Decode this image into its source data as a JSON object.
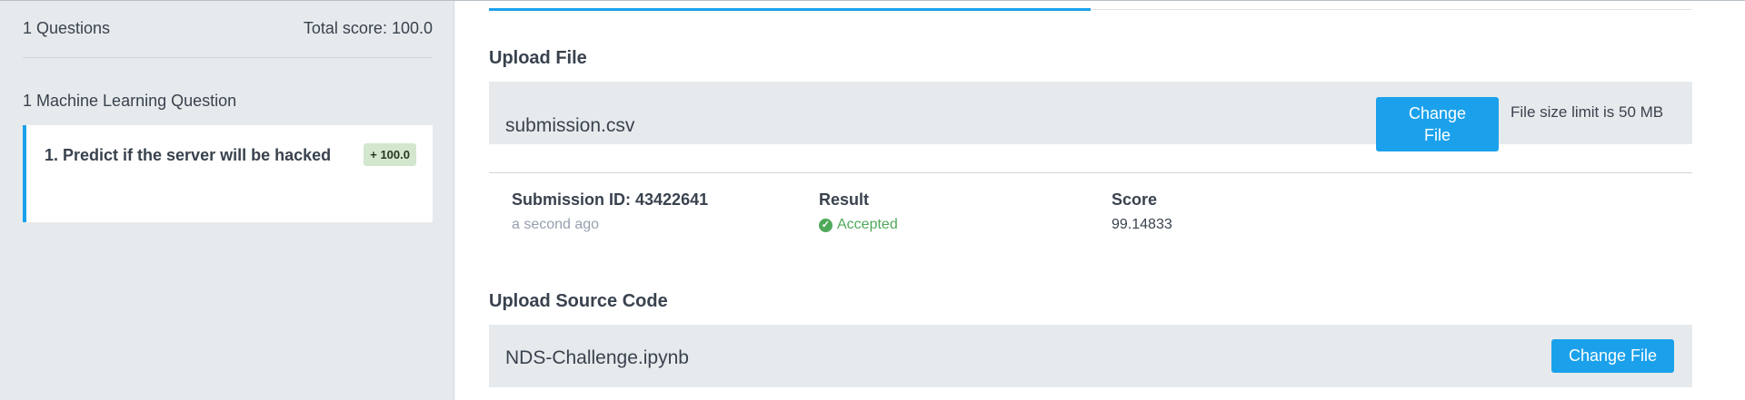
{
  "sidebar": {
    "questions_count": "1 Questions",
    "total_score": "Total score: 100.0",
    "section_title": "1 Machine Learning Question",
    "question": {
      "title": "1. Predict if the server will be hacked",
      "badge": "+ 100.0"
    }
  },
  "upload_file": {
    "heading": "Upload File",
    "file_name": "submission.csv",
    "button_label": "Change File",
    "limit_text": "File size limit is 50 MB"
  },
  "submission": {
    "id_label": "Submission ID: 43422641",
    "time": "a second ago",
    "result_label": "Result",
    "result_value": "Accepted",
    "score_label": "Score",
    "score_value": "99.14833"
  },
  "upload_source": {
    "heading": "Upload Source Code",
    "file_name": "NDS-Challenge.ipynb",
    "button_label": "Change File"
  },
  "colors": {
    "accent": "#1ba1ec",
    "success": "#4fa95a",
    "panel_bg": "#e7eaec"
  },
  "icons": {
    "accepted": "check-circle-icon"
  }
}
